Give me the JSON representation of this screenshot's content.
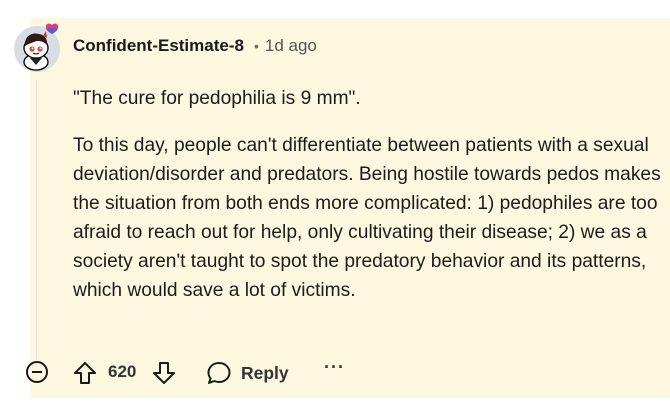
{
  "comment": {
    "author": "Confident-Estimate-8",
    "separator": "•",
    "timestamp": "1d ago",
    "paragraphs": [
      "\"The cure for pedophilia is 9 mm\".",
      "To this day, people can't differentiate between patients with a sexual deviation/disorder and predators. Being hostile towards pedos makes the situation from both ends more complicated: 1) pedophiles are too afraid to reach out for help, only cultivating their disease; 2) we as a society aren't taught to spot the predatory behavior and its patterns, which would save a lot of victims."
    ]
  },
  "actions": {
    "score": "620",
    "reply_label": "Reply",
    "more_label": "···"
  },
  "colors": {
    "highlight_background": "#fcf8df",
    "text": "#1a1a1b",
    "meta_text": "#555555",
    "avatar_background": "#d7dde2"
  },
  "icons": {
    "avatar": "snoo-avatar-icon",
    "collapse": "collapse-minus-icon",
    "upvote": "upvote-arrow-icon",
    "downvote": "downvote-arrow-icon",
    "reply": "speech-bubble-icon",
    "more": "ellipsis-icon"
  }
}
